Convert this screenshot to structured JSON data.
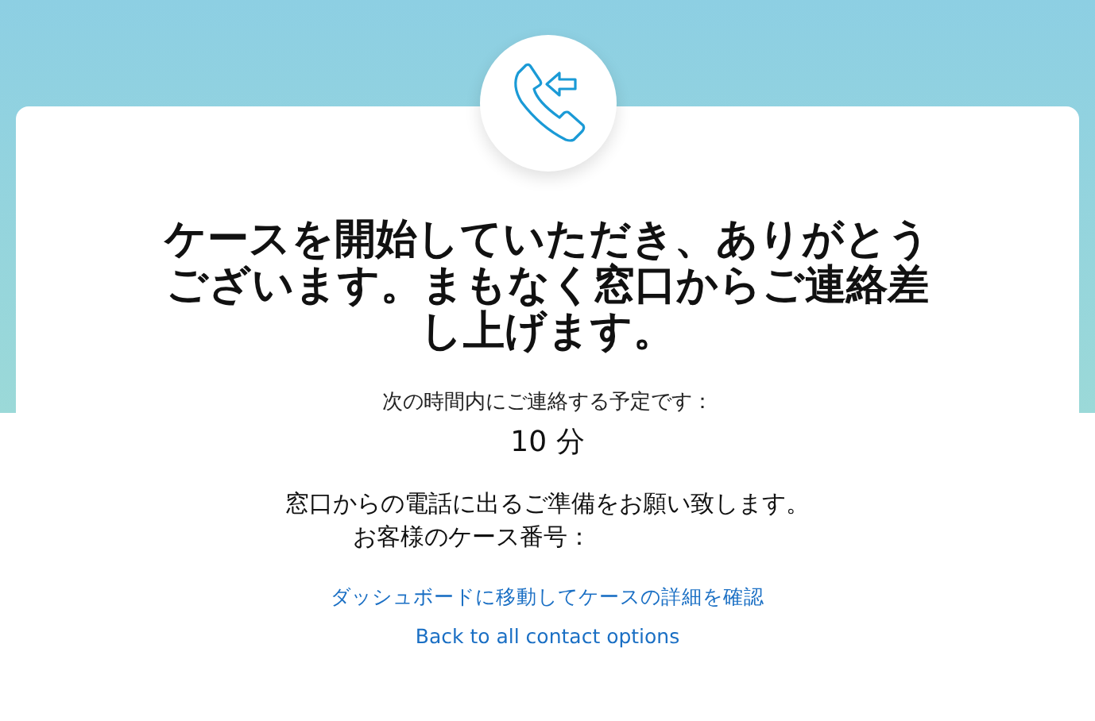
{
  "heading": "ケースを開始していただき、ありがとうございます。まもなく窓口からご連絡差し上げます。",
  "eta_label": "次の時間内にご連絡する予定です：",
  "eta_value": "10 分",
  "instruction": "窓口からの電話に出るご準備をお願い致します。",
  "case_number_label": "お客様のケース番号：",
  "links": [
    {
      "label": "ダッシュボードに移動してケースの詳細を確認"
    },
    {
      "label": "Back to all contact options"
    }
  ]
}
